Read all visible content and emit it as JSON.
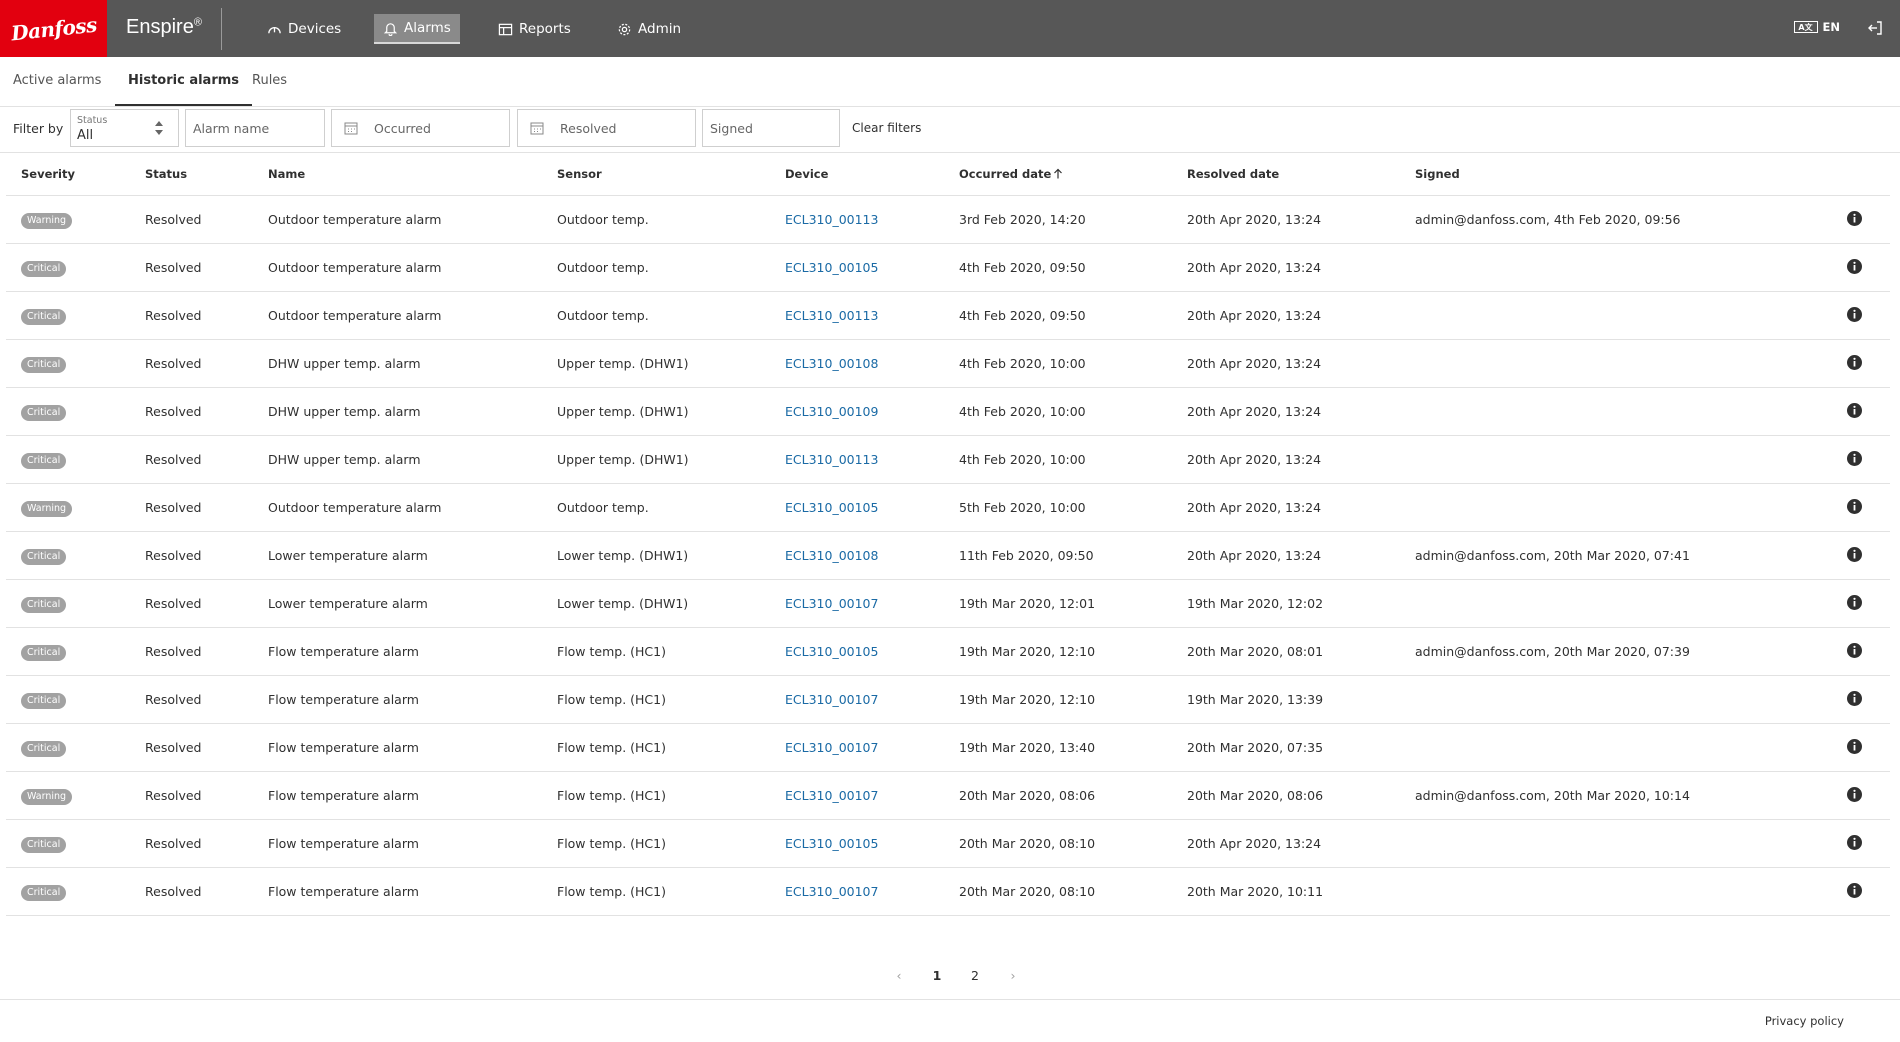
{
  "header": {
    "logo_text": "Danfoss",
    "brand": "Enspire",
    "brand_mark": "®",
    "nav": [
      {
        "label": "Devices",
        "icon": "gauge-icon"
      },
      {
        "label": "Alarms",
        "icon": "bell-icon"
      },
      {
        "label": "Reports",
        "icon": "table-icon"
      },
      {
        "label": "Admin",
        "icon": "gear-icon"
      }
    ],
    "active_nav": "Alarms",
    "language": "EN",
    "language_icon_text": "A文"
  },
  "tabs": [
    {
      "label": "Active alarms"
    },
    {
      "label": "Historic alarms"
    },
    {
      "label": "Rules"
    }
  ],
  "active_tab": "Historic alarms",
  "filters": {
    "label": "Filter by",
    "status_label": "Status",
    "status_value": "All",
    "alarm_name_placeholder": "Alarm name",
    "occurred_placeholder": "Occurred",
    "resolved_placeholder": "Resolved",
    "signed_placeholder": "Signed",
    "clear_label": "Clear filters"
  },
  "table": {
    "columns": [
      "Severity",
      "Status",
      "Name",
      "Sensor",
      "Device",
      "Occurred date",
      "Resolved date",
      "Signed"
    ],
    "sorted_column": "Occurred date",
    "sort_direction": "ascending",
    "rows": [
      {
        "severity": "Warning",
        "status": "Resolved",
        "name": "Outdoor temperature alarm",
        "sensor": "Outdoor temp.",
        "device": "ECL310_00113",
        "occurred": "3rd Feb 2020, 14:20",
        "resolved": "20th Apr 2020, 13:24",
        "signed": "admin@danfoss.com, 4th Feb 2020, 09:56"
      },
      {
        "severity": "Critical",
        "status": "Resolved",
        "name": "Outdoor temperature alarm",
        "sensor": "Outdoor temp.",
        "device": "ECL310_00105",
        "occurred": "4th Feb 2020, 09:50",
        "resolved": "20th Apr 2020, 13:24",
        "signed": ""
      },
      {
        "severity": "Critical",
        "status": "Resolved",
        "name": "Outdoor temperature alarm",
        "sensor": "Outdoor temp.",
        "device": "ECL310_00113",
        "occurred": "4th Feb 2020, 09:50",
        "resolved": "20th Apr 2020, 13:24",
        "signed": ""
      },
      {
        "severity": "Critical",
        "status": "Resolved",
        "name": "DHW upper temp. alarm",
        "sensor": "Upper temp. (DHW1)",
        "device": "ECL310_00108",
        "occurred": "4th Feb 2020, 10:00",
        "resolved": "20th Apr 2020, 13:24",
        "signed": ""
      },
      {
        "severity": "Critical",
        "status": "Resolved",
        "name": "DHW upper temp. alarm",
        "sensor": "Upper temp. (DHW1)",
        "device": "ECL310_00109",
        "occurred": "4th Feb 2020, 10:00",
        "resolved": "20th Apr 2020, 13:24",
        "signed": ""
      },
      {
        "severity": "Critical",
        "status": "Resolved",
        "name": "DHW upper temp. alarm",
        "sensor": "Upper temp. (DHW1)",
        "device": "ECL310_00113",
        "occurred": "4th Feb 2020, 10:00",
        "resolved": "20th Apr 2020, 13:24",
        "signed": ""
      },
      {
        "severity": "Warning",
        "status": "Resolved",
        "name": "Outdoor temperature alarm",
        "sensor": "Outdoor temp.",
        "device": "ECL310_00105",
        "occurred": "5th Feb 2020, 10:00",
        "resolved": "20th Apr 2020, 13:24",
        "signed": ""
      },
      {
        "severity": "Critical",
        "status": "Resolved",
        "name": "Lower temperature alarm",
        "sensor": "Lower temp. (DHW1)",
        "device": "ECL310_00108",
        "occurred": "11th Feb 2020, 09:50",
        "resolved": "20th Apr 2020, 13:24",
        "signed": "admin@danfoss.com, 20th Mar 2020, 07:41"
      },
      {
        "severity": "Critical",
        "status": "Resolved",
        "name": "Lower temperature alarm",
        "sensor": "Lower temp. (DHW1)",
        "device": "ECL310_00107",
        "occurred": "19th Mar 2020, 12:01",
        "resolved": "19th Mar 2020, 12:02",
        "signed": ""
      },
      {
        "severity": "Critical",
        "status": "Resolved",
        "name": "Flow temperature alarm",
        "sensor": "Flow temp. (HC1)",
        "device": "ECL310_00105",
        "occurred": "19th Mar 2020, 12:10",
        "resolved": "20th Mar 2020, 08:01",
        "signed": "admin@danfoss.com, 20th Mar 2020, 07:39"
      },
      {
        "severity": "Critical",
        "status": "Resolved",
        "name": "Flow temperature alarm",
        "sensor": "Flow temp. (HC1)",
        "device": "ECL310_00107",
        "occurred": "19th Mar 2020, 12:10",
        "resolved": "19th Mar 2020, 13:39",
        "signed": ""
      },
      {
        "severity": "Critical",
        "status": "Resolved",
        "name": "Flow temperature alarm",
        "sensor": "Flow temp. (HC1)",
        "device": "ECL310_00107",
        "occurred": "19th Mar 2020, 13:40",
        "resolved": "20th Mar 2020, 07:35",
        "signed": ""
      },
      {
        "severity": "Warning",
        "status": "Resolved",
        "name": "Flow temperature alarm",
        "sensor": "Flow temp. (HC1)",
        "device": "ECL310_00107",
        "occurred": "20th Mar 2020, 08:06",
        "resolved": "20th Mar 2020, 08:06",
        "signed": "admin@danfoss.com, 20th Mar 2020, 10:14"
      },
      {
        "severity": "Critical",
        "status": "Resolved",
        "name": "Flow temperature alarm",
        "sensor": "Flow temp. (HC1)",
        "device": "ECL310_00105",
        "occurred": "20th Mar 2020, 08:10",
        "resolved": "20th Apr 2020, 13:24",
        "signed": ""
      },
      {
        "severity": "Critical",
        "status": "Resolved",
        "name": "Flow temperature alarm",
        "sensor": "Flow temp. (HC1)",
        "device": "ECL310_00107",
        "occurred": "20th Mar 2020, 08:10",
        "resolved": "20th Mar 2020, 10:11",
        "signed": ""
      }
    ]
  },
  "pagination": {
    "pages": [
      "1",
      "2"
    ],
    "current": "1",
    "prev": "‹",
    "next": "›"
  },
  "footer": {
    "privacy": "Privacy policy"
  },
  "colors": {
    "header_bg": "#575757",
    "logo_red": "#e2000f",
    "link": "#1a6aa5",
    "badge": "#a2a2a2"
  }
}
